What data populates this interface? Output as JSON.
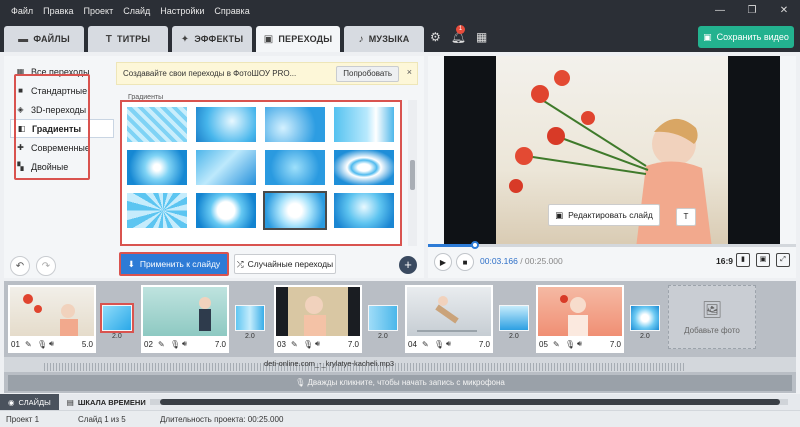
{
  "menu": [
    "Файл",
    "Правка",
    "Проект",
    "Слайд",
    "Настройки",
    "Справка"
  ],
  "window_controls": [
    "—",
    "❐",
    "✕"
  ],
  "tabs": [
    {
      "label": "ФАЙЛЫ",
      "icon": "folder-icon"
    },
    {
      "label": "ТИТРЫ",
      "icon": "text-t-icon"
    },
    {
      "label": "ЭФФЕКТЫ",
      "icon": "star-effects-icon"
    },
    {
      "label": "ПЕРЕХОДЫ",
      "icon": "transitions-icon"
    },
    {
      "label": "МУЗЫКА",
      "icon": "music-icon"
    }
  ],
  "notification_count": "1",
  "save_button": "Сохранить видео",
  "categories": [
    "Все переходы",
    "Стандартные",
    "3D-переходы",
    "Градиенты",
    "Современные",
    "Двойные"
  ],
  "active_category": "Градиенты",
  "promo": {
    "text": "Создавайте свои переходы в ФотоШОУ PRO...",
    "button": "Попробовать",
    "close": "×"
  },
  "gallery_label": "Градиенты",
  "apply_button": "Применить к слайду",
  "random_button": "Случайные переходы",
  "edit_slide_button": "Редактировать слайд",
  "playback": {
    "current": "00:03.166",
    "separator": " / ",
    "total": "00:25.000",
    "ratio": "16:9",
    "progress": 0.127
  },
  "slides": [
    {
      "num": "01",
      "duration": "5.0"
    },
    {
      "num": "02",
      "duration": "7.0"
    },
    {
      "num": "03",
      "duration": "7.0"
    },
    {
      "num": "04",
      "duration": "7.0"
    },
    {
      "num": "05",
      "duration": "7.0"
    }
  ],
  "transition_duration": "2.0",
  "add_photo": "Добавьте фото",
  "music_track": "deti-online.com_-_krylatye-kacheli.mp3",
  "mic_prompt": "Дважды кликните, чтобы начать запись с микрофона",
  "view_tabs": [
    "СЛАЙДЫ",
    "ШКАЛА ВРЕМЕНИ"
  ],
  "status": {
    "project": "Проект 1",
    "slide": "Слайд 1 из 5",
    "duration": "Длительность проекта: 00:25.000"
  },
  "colors": {
    "accent": "#2d7bd6",
    "save": "#23b28f",
    "highlight": "#d9534f",
    "titlebar": "#2b2f36"
  }
}
